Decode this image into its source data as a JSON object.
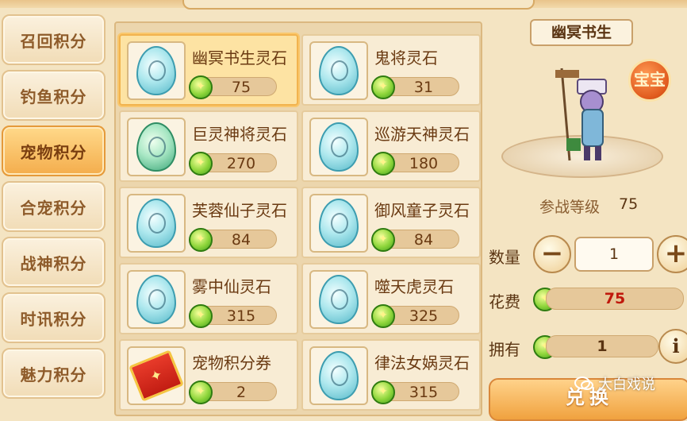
{
  "tabs": [
    {
      "label": "召回积分",
      "active": false
    },
    {
      "label": "钓鱼积分",
      "active": false
    },
    {
      "label": "宠物积分",
      "active": true
    },
    {
      "label": "合宠积分",
      "active": false
    },
    {
      "label": "战神积分",
      "active": false
    },
    {
      "label": "时讯积分",
      "active": false
    },
    {
      "label": "魅力积分",
      "active": false
    }
  ],
  "items": [
    {
      "name": "幽冥书生灵石",
      "price": "75",
      "icon": "egg-icon",
      "selected": true
    },
    {
      "name": "鬼将灵石",
      "price": "31",
      "icon": "egg-icon"
    },
    {
      "name": "巨灵神将灵石",
      "price": "270",
      "icon": "egg-icon"
    },
    {
      "name": "巡游天神灵石",
      "price": "180",
      "icon": "egg-icon"
    },
    {
      "name": "芙蓉仙子灵石",
      "price": "84",
      "icon": "egg-icon"
    },
    {
      "name": "御风童子灵石",
      "price": "84",
      "icon": "egg-icon"
    },
    {
      "name": "雾中仙灵石",
      "price": "315",
      "icon": "egg-icon"
    },
    {
      "name": "噬天虎灵石",
      "price": "325",
      "icon": "egg-icon"
    },
    {
      "name": "宠物积分券",
      "price": "2",
      "icon": "coupon-icon"
    },
    {
      "name": "律法女娲灵石",
      "price": "315",
      "icon": "egg-icon"
    }
  ],
  "detail": {
    "pet_name": "幽冥书生",
    "treasure_badge": "宝宝",
    "level_label": "参战等级",
    "level_value": "75",
    "qty_label": "数量",
    "qty_value": "1",
    "minus": "−",
    "plus": "+",
    "cost_label": "花费",
    "cost_value": "75",
    "own_label": "拥有",
    "own_value": "1",
    "info": "i",
    "exchange_label": "兑换"
  },
  "watermark": "大白戏说",
  "colors": {
    "accent": "#f4ad4c",
    "cost_text": "#c0180c",
    "coin": "#8fd63c"
  }
}
